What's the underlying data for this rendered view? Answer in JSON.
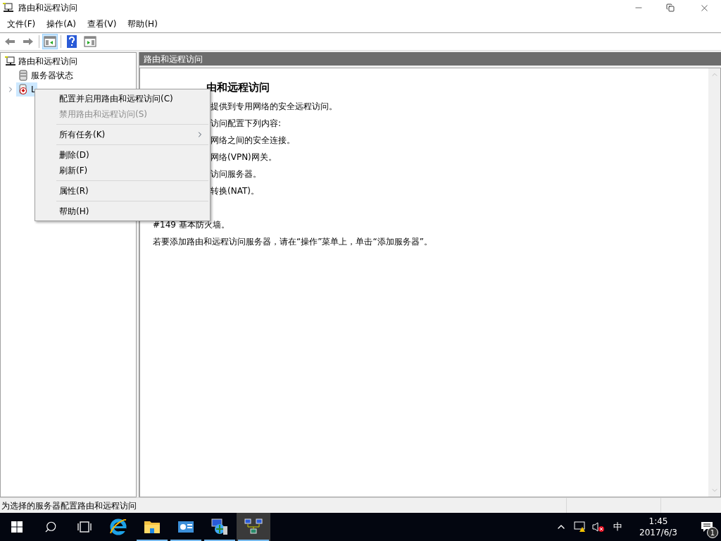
{
  "window": {
    "title": "路由和远程访问"
  },
  "menu_bar": [
    "文件(F)",
    "操作(A)",
    "查看(V)",
    "帮助(H)"
  ],
  "toolbar": [
    {
      "kind": "back",
      "selected": false
    },
    {
      "kind": "forward",
      "selected": false
    },
    {
      "kind": "tree",
      "selected": true
    },
    {
      "kind": "help",
      "selected": false
    },
    {
      "kind": "action",
      "selected": false
    }
  ],
  "tree": [
    {
      "label": "路由和远程访问",
      "kind": "root",
      "selected": false,
      "children": [
        {
          "label": "服务器状态",
          "kind": "status",
          "selected": false
        },
        {
          "label": "L",
          "kind": "server",
          "selected": true,
          "expanded": false
        }
      ]
    }
  ],
  "panel": {
    "header": "路由和远程访问",
    "heading": "由和远程访问",
    "lines": [
      "提供到专用网络的安全远程访问。",
      "访问配置下列内容:",
      "网络之间的安全连接。",
      "网络(VPN)网关。",
      "访问服务器。",
      "转换(NAT)。"
    ],
    "full_lines": [
      "#149 基本防火墙。",
      "若要添加路由和远程访问服务器，请在“操作”菜单上，单击“添加服务器”。"
    ]
  },
  "context_menu": [
    {
      "label": "配置并启用路由和远程访问(C)",
      "disabled": false,
      "submenu": false,
      "divider_above": false
    },
    {
      "label": "禁用路由和远程访问(S)",
      "disabled": true,
      "submenu": false,
      "divider_above": false
    },
    {
      "label": "所有任务(K)",
      "disabled": false,
      "submenu": true,
      "divider_above": true
    },
    {
      "label": "删除(D)",
      "disabled": false,
      "submenu": false,
      "divider_above": true
    },
    {
      "label": "刷新(F)",
      "disabled": false,
      "submenu": false,
      "divider_above": false
    },
    {
      "label": "属性(R)",
      "disabled": false,
      "submenu": false,
      "divider_above": true
    },
    {
      "label": "帮助(H)",
      "disabled": false,
      "submenu": false,
      "divider_above": true
    }
  ],
  "status_bar": {
    "text": "为选择的服务器配置路由和远程访问"
  },
  "taskbar": {
    "apps": [
      {
        "kind": "ie",
        "open": false,
        "selected": false
      },
      {
        "kind": "explorer",
        "open": true,
        "selected": false
      },
      {
        "kind": "dashboard",
        "open": true,
        "selected": false
      },
      {
        "kind": "network",
        "open": true,
        "selected": false
      },
      {
        "kind": "routing",
        "open": true,
        "selected": true
      }
    ],
    "ime": "中",
    "time": "1:45",
    "date": "2017/6/3",
    "notifications": "1"
  }
}
